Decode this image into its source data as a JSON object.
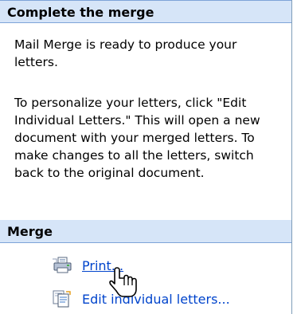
{
  "task_pane": {
    "section_title": "Complete the merge",
    "paragraphs": [
      "Mail Merge is ready to produce your letters.",
      "To personalize your letters, click \"Edit Individual Letters.\" This will open a new document with your merged letters. To make changes to all the letters, switch back to the original document."
    ],
    "merge_section": {
      "title": "Merge",
      "actions": [
        {
          "label": "Print...",
          "icon": "printer-icon"
        },
        {
          "label": "Edit individual letters...",
          "icon": "edit-letters-icon"
        }
      ]
    }
  },
  "cursor": {
    "icon": "hand-pointer-icon"
  },
  "colors": {
    "header_bg": "#d6e5f8",
    "header_border": "#7ea4d8",
    "link": "#0044cc",
    "pane_border": "#7f9db9"
  }
}
